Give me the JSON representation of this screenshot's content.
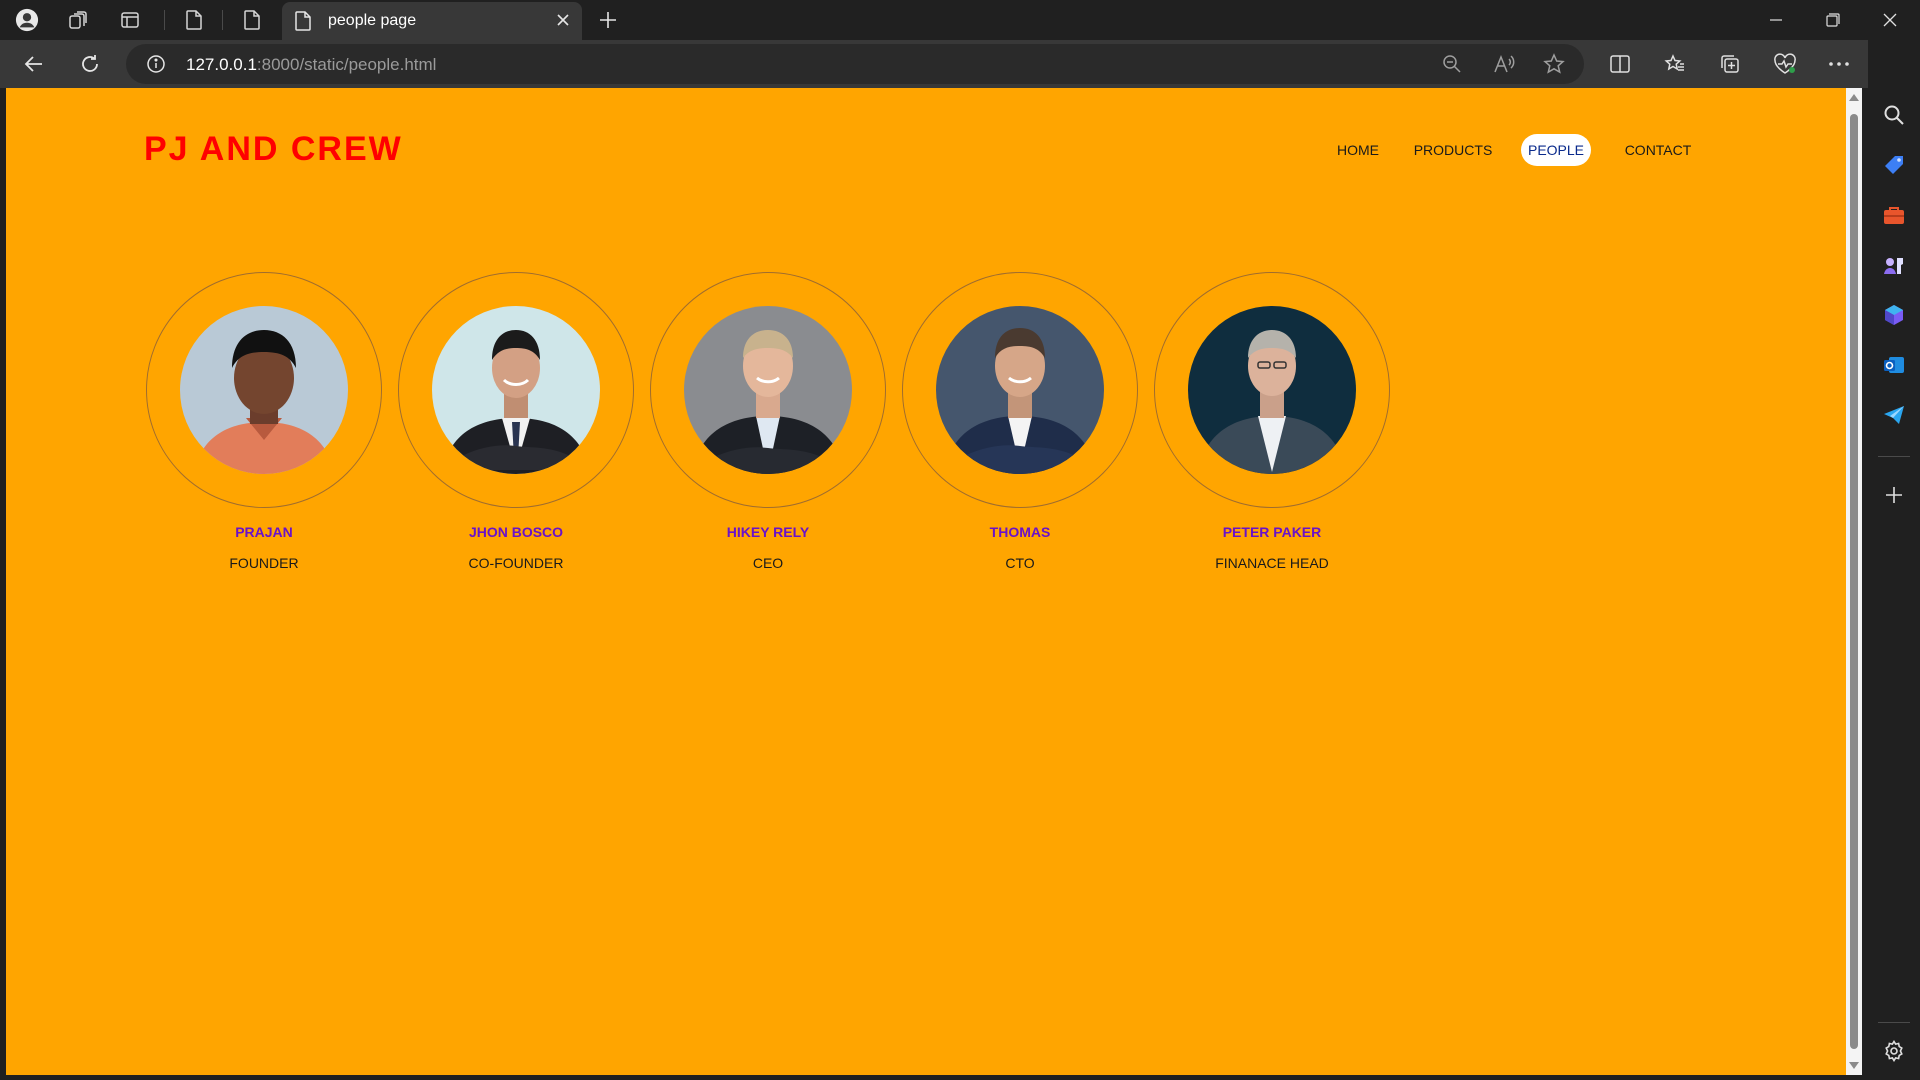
{
  "browser": {
    "tab_title": "people page",
    "url_host": "127.0.0.1",
    "url_path": ":8000/static/people.html"
  },
  "site": {
    "logo": "PJ AND CREW",
    "nav": {
      "home": "HOME",
      "products": "PRODUCTS",
      "people": "PEOPLE",
      "contact": "CONTACT"
    },
    "active_nav": "PEOPLE"
  },
  "people": [
    {
      "name": "PRAJAN",
      "role": "FOUNDER"
    },
    {
      "name": "JHON BOSCO",
      "role": "CO-FOUNDER"
    },
    {
      "name": "HIKEY RELY",
      "role": "CEO"
    },
    {
      "name": "THOMAS",
      "role": "CTO"
    },
    {
      "name": "PETER PAKER",
      "role": "FINANACE HEAD"
    }
  ],
  "colors": {
    "page_background": "#ffa500",
    "logo": "#ff0000",
    "person_name": "#6a12c9",
    "browser_chrome": "#202020"
  }
}
